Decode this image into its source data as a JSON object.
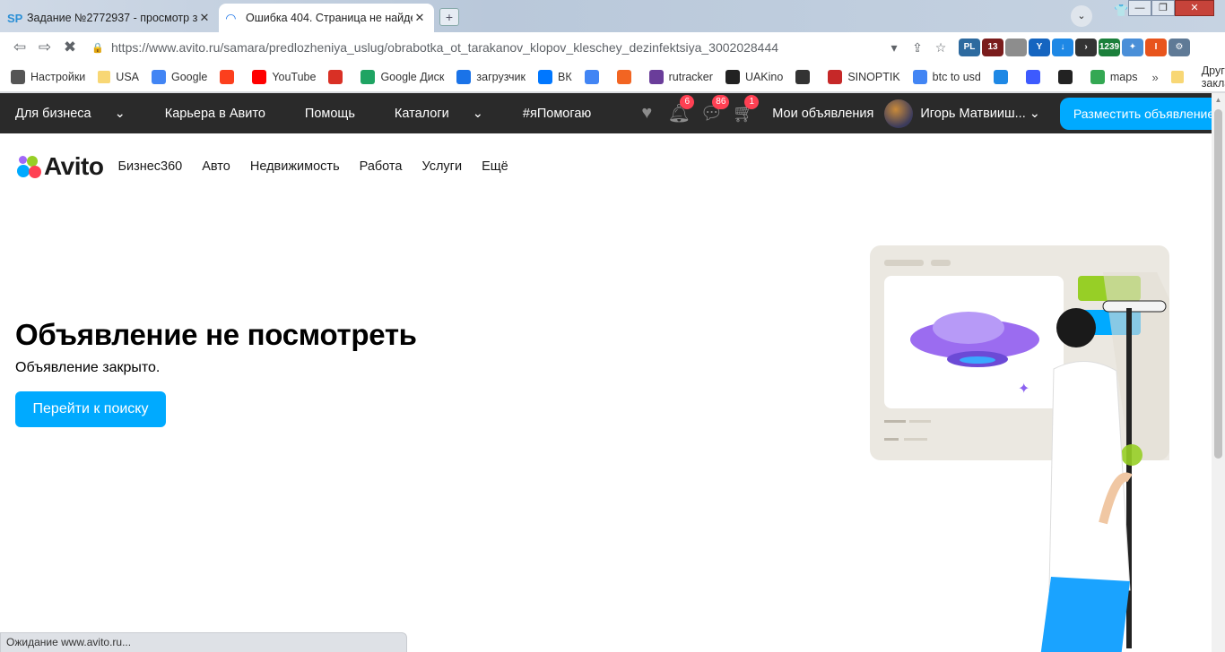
{
  "browser": {
    "tabs": [
      {
        "favicon": "SP",
        "title": "Задание №2772937 - просмотр з"
      },
      {
        "favicon": "loading-spinner",
        "title": "Ошибка 404. Страница не найде"
      }
    ],
    "url_prefix": "https://www.avito.ru",
    "url_path": "/samara/predlozheniya_uslug/obrabotka_ot_tarakanov_klopov_kleschey_dezinfektsiya_3002028444",
    "extensions": [
      {
        "label": "PL",
        "color": "#2d6a9f"
      },
      {
        "label": "13",
        "color": "#7a1c1c"
      },
      {
        "label": "",
        "color": "#8d8d8d"
      },
      {
        "label": "Y",
        "color": "#1565c0"
      },
      {
        "label": "↓",
        "color": "#1e88e5"
      },
      {
        "label": "›",
        "color": "#333333"
      },
      {
        "label": "1239",
        "color": "#1b7f3b"
      },
      {
        "label": "✦",
        "color": "#4a8fd8"
      },
      {
        "label": "I",
        "color": "#e8541c"
      },
      {
        "label": "⚙",
        "color": "#5f7a96"
      }
    ],
    "bookmarks": [
      {
        "label": "Настройки",
        "icon": "gear-icon",
        "color": "#555555"
      },
      {
        "label": "USA",
        "icon": "folder-icon",
        "color": "#f8d775"
      },
      {
        "label": "Google",
        "icon": "google-icon",
        "color": "#4285f4"
      },
      {
        "label": "",
        "icon": "yandex-icon",
        "color": "#fc3f1d"
      },
      {
        "label": "YouTube",
        "icon": "youtube-icon",
        "color": "#ff0000"
      },
      {
        "label": "",
        "icon": "gmail-icon",
        "color": "#d93025"
      },
      {
        "label": "Google Диск",
        "icon": "drive-icon",
        "color": "#1fa463"
      },
      {
        "label": "загрузчик",
        "icon": "infinity-icon",
        "color": "#1a73e8"
      },
      {
        "label": "ВК",
        "icon": "vk-icon",
        "color": "#0077ff"
      },
      {
        "label": "",
        "icon": "translate-icon",
        "color": "#4285f4"
      },
      {
        "label": "",
        "icon": "f-icon",
        "color": "#f26522"
      },
      {
        "label": "rutracker",
        "icon": "rutracker-icon",
        "color": "#6a3d9a"
      },
      {
        "label": "UAKino",
        "icon": "uakino-icon",
        "color": "#222222"
      },
      {
        "label": "",
        "icon": "chess-icon",
        "color": "#333333"
      },
      {
        "label": "SINOPTIK",
        "icon": "thermometer-icon",
        "color": "#c62828"
      },
      {
        "label": "btc to usd",
        "icon": "google-icon",
        "color": "#4285f4"
      },
      {
        "label": "",
        "icon": "p-icon",
        "color": "#1e88e5"
      },
      {
        "label": "",
        "icon": "arrow-icon",
        "color": "#3d5afe"
      },
      {
        "label": "",
        "icon": "bc-icon",
        "color": "#222222"
      },
      {
        "label": "maps",
        "icon": "maps-icon",
        "color": "#34a853"
      }
    ],
    "bookmarks_more": "»",
    "other_bookmarks": "Другие закладки",
    "status_text": "Ожидание www.avito.ru..."
  },
  "avito": {
    "topbar": {
      "items": [
        "Для бизнеса",
        "Карьера в Авито",
        "Помощь",
        "Каталоги",
        "#яПомогаю"
      ],
      "dropdown_items": [
        0,
        3
      ],
      "notifications_badge": "6",
      "messages_badge": "86",
      "cart_badge": "1",
      "my_ads": "Мои объявления",
      "username": "Игорь Матвииш...",
      "post_ad_button": "Разместить объявление"
    },
    "logo_text": "Avito",
    "nav": [
      "Бизнес360",
      "Авто",
      "Недвижимость",
      "Работа",
      "Услуги",
      "Ещё"
    ],
    "error": {
      "title": "Объявление не посмотреть",
      "subtitle": "Объявление закрыто.",
      "button": "Перейти к поиску"
    },
    "colors": {
      "accent": "#00aaff",
      "topbar_bg": "#2a2a2a",
      "badge": "#ff4053"
    }
  }
}
